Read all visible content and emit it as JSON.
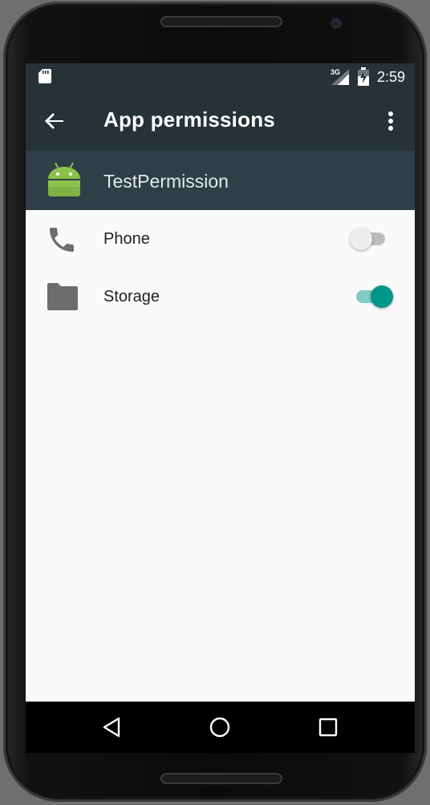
{
  "status_bar": {
    "network_type": "3G",
    "time": "2:59",
    "icons": [
      "sd-card-icon",
      "signal-icon",
      "battery-charging-icon"
    ]
  },
  "toolbar": {
    "title": "App permissions",
    "back_icon": "arrow-back-icon",
    "menu_icon": "more-vert-icon"
  },
  "app": {
    "name": "TestPermission",
    "icon": "android-robot-icon"
  },
  "permissions": [
    {
      "label": "Phone",
      "icon": "phone-icon",
      "enabled": false
    },
    {
      "label": "Storage",
      "icon": "folder-icon",
      "enabled": true
    }
  ],
  "nav_bar": {
    "icons": [
      "nav-back-icon",
      "nav-home-icon",
      "nav-recents-icon"
    ]
  },
  "colors": {
    "status_bar": "#263238",
    "toolbar": "#263238",
    "app_header": "#2e3f48",
    "background": "#fafafa",
    "accent": "#009688",
    "android_green": "#8bc34a"
  }
}
